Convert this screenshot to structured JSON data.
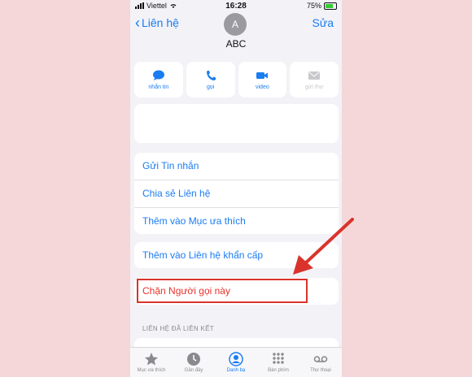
{
  "status_bar": {
    "carrier": "Viettel",
    "time": "16:28",
    "battery": "75%"
  },
  "nav": {
    "back_label": "Liên hệ",
    "edit_label": "Sửa"
  },
  "contact": {
    "initial": "A",
    "name": "ABC"
  },
  "actions": [
    {
      "label": "nhắn tin",
      "icon": "message-icon"
    },
    {
      "label": "gọi",
      "icon": "phone-icon"
    },
    {
      "label": "video",
      "icon": "video-icon"
    },
    {
      "label": "gửi thư",
      "icon": "mail-icon"
    }
  ],
  "menu": {
    "send_message": "Gửi Tin nhắn",
    "share_contact": "Chia sẻ Liên hệ",
    "add_favorite": "Thêm vào Mục ưa thích",
    "add_emergency": "Thêm vào Liên hệ khẩn cấp",
    "block_caller": "Chặn Người gọi này"
  },
  "linked_header": "LIÊN HỆ ĐÃ LIÊN KẾT",
  "tabs": [
    {
      "label": "Mục ưa thích",
      "icon": "star-icon"
    },
    {
      "label": "Gần đây",
      "icon": "clock-icon"
    },
    {
      "label": "Danh bạ",
      "icon": "contacts-icon"
    },
    {
      "label": "Bàn phím",
      "icon": "keypad-icon"
    },
    {
      "label": "Thư thoại",
      "icon": "voicemail-icon"
    }
  ],
  "colors": {
    "accent": "#1a7cf2",
    "destructive": "#e8322b",
    "highlight_box": "#d9332b",
    "background": "#f5d7d9"
  }
}
